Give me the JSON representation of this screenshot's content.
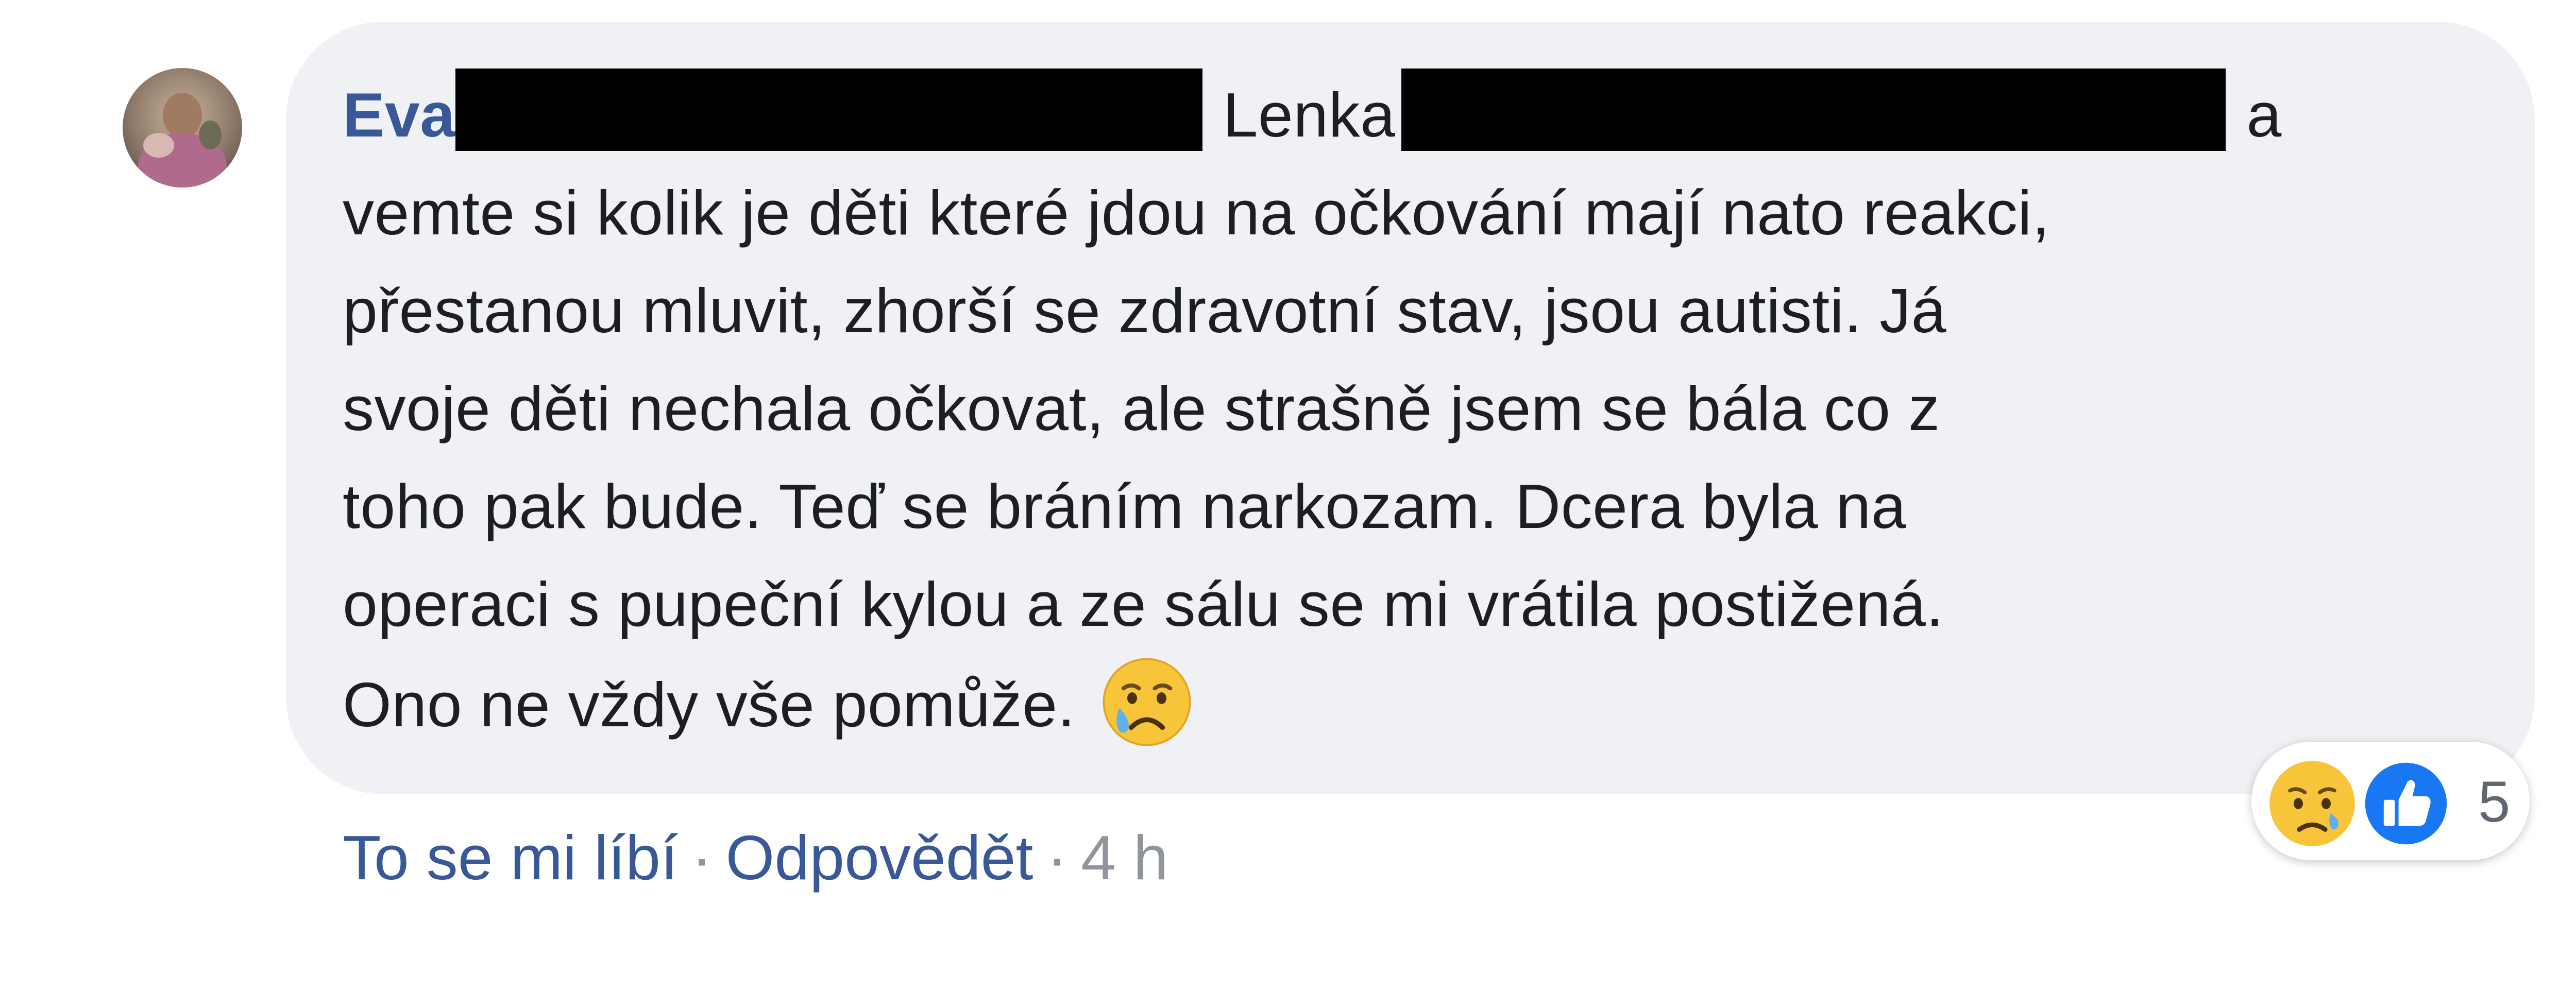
{
  "comment": {
    "author": "Eva",
    "mention": "Lenka",
    "line_1_tail": "a",
    "lines": [
      "vemte si kolik je děti které jdou na očkování mají nato reakci,",
      "přestanou mluvit, zhorší se zdravotní stav, jsou autisti. Já",
      "svoje děti nechala očkovat, ale strašně jsem se bála co z",
      "toho pak bude. Teď se bráním narkozam. Dcera byla na",
      "operaci s pupeční kylou a ze sálu se mi vrátila postižená."
    ],
    "last_line": "Ono ne vždy vše pomůže.",
    "emoji": "crying-face-icon"
  },
  "actions": {
    "like": "To se mi líbí",
    "separator": "·",
    "reply": "Odpovědět",
    "time": "4 h"
  },
  "reactions": {
    "icons": [
      "sad-reaction-icon",
      "like-reaction-icon"
    ],
    "count": "5"
  },
  "colors": {
    "bubble": "#eff1f4",
    "author": "#385898",
    "text": "#1c1e21",
    "meta": "#90949c",
    "like_blue": "#1877f2"
  }
}
